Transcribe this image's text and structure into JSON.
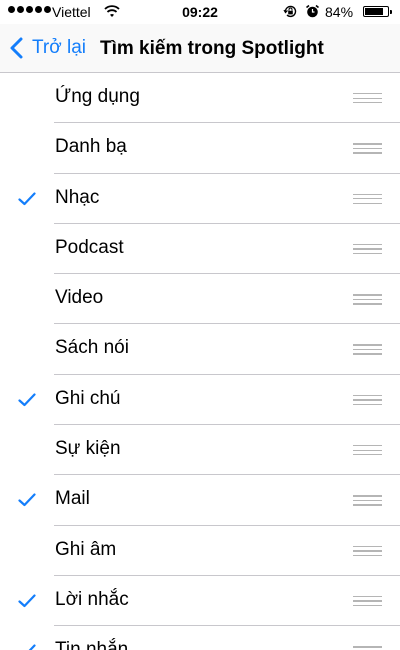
{
  "status_bar": {
    "carrier": "Viettel",
    "time": "09:22",
    "battery_percent": "84%",
    "battery_level": 0.84,
    "icons": [
      "signal-dots-icon",
      "wifi-icon",
      "rotation-lock-icon",
      "alarm-icon",
      "battery-icon"
    ]
  },
  "nav": {
    "back_label": "Trở lại",
    "title": "Tìm kiếm trong Spotlight"
  },
  "accent_color": "#147efb",
  "items": [
    {
      "label": "Ứng dụng",
      "checked": false
    },
    {
      "label": "Danh bạ",
      "checked": false
    },
    {
      "label": "Nhạc",
      "checked": true
    },
    {
      "label": "Podcast",
      "checked": false
    },
    {
      "label": "Video",
      "checked": false
    },
    {
      "label": "Sách nói",
      "checked": false
    },
    {
      "label": "Ghi chú",
      "checked": true
    },
    {
      "label": "Sự kiện",
      "checked": false
    },
    {
      "label": "Mail",
      "checked": true
    },
    {
      "label": "Ghi âm",
      "checked": false
    },
    {
      "label": "Lời nhắc",
      "checked": true
    },
    {
      "label": "Tin nhắn",
      "checked": true
    }
  ]
}
